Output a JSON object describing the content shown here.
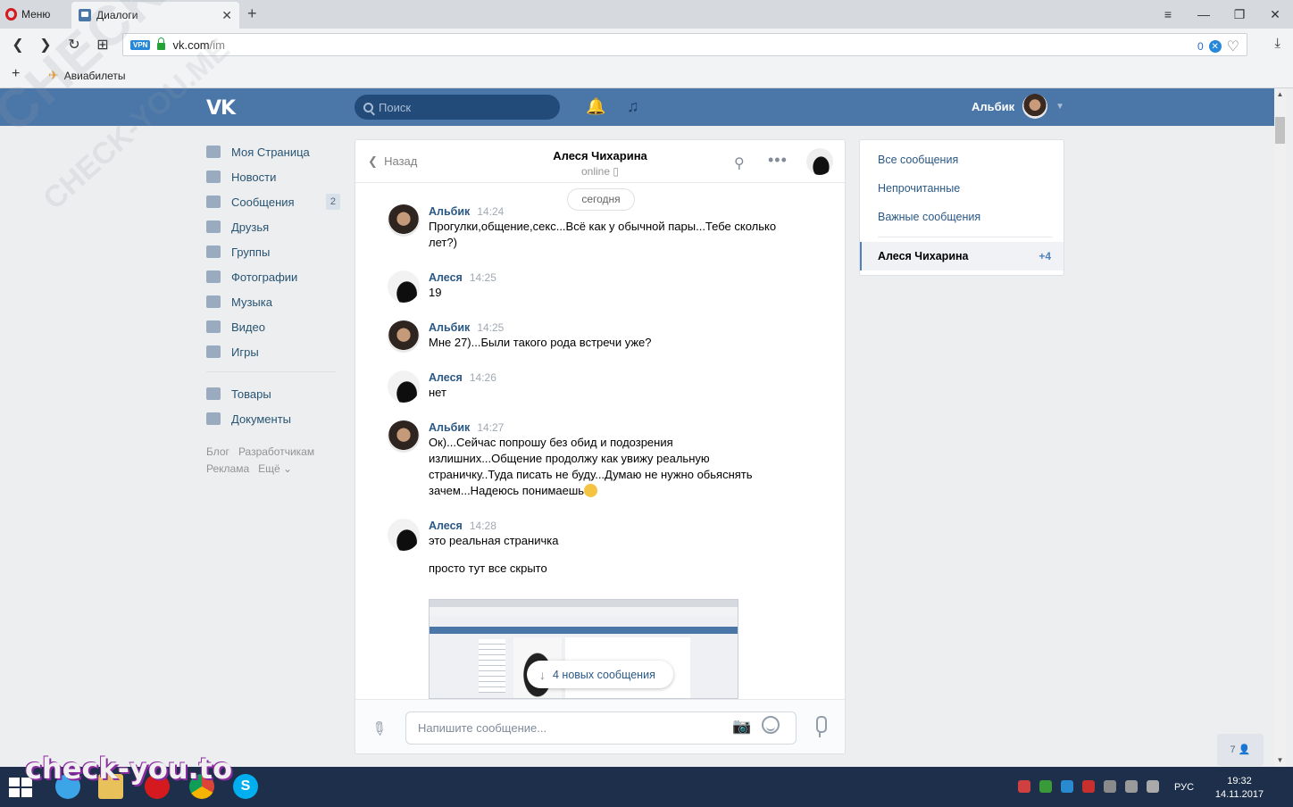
{
  "browser": {
    "menu_label": "Меню",
    "tab_title": "Диалоги",
    "url_host": "vk.com",
    "url_path": "/im",
    "vpn_label": "VPN",
    "adblock_count": "0",
    "bookmark_label": "Авиабилеты"
  },
  "header": {
    "logo": "VK",
    "search_placeholder": "Поиск",
    "user_name": "Альбик"
  },
  "sidebar": {
    "items": [
      {
        "label": "Моя Страница"
      },
      {
        "label": "Новости"
      },
      {
        "label": "Сообщения",
        "badge": "2"
      },
      {
        "label": "Друзья"
      },
      {
        "label": "Группы"
      },
      {
        "label": "Фотографии"
      },
      {
        "label": "Музыка"
      },
      {
        "label": "Видео"
      },
      {
        "label": "Игры"
      }
    ],
    "items2": [
      {
        "label": "Товары"
      },
      {
        "label": "Документы"
      }
    ],
    "footer": {
      "blog": "Блог",
      "developers": "Разработчикам",
      "ads": "Реклама",
      "more": "Ещё ⌄"
    }
  },
  "chat": {
    "back_label": "Назад",
    "peer_name": "Алеся Чихарина",
    "peer_status": "online",
    "date_label": "сегодня",
    "messages": [
      {
        "author": "Альбик",
        "time": "14:24",
        "text": "Прогулки,общение,секс...Всё как у обычной пары...Тебе сколько лет?)"
      },
      {
        "author": "Алеся",
        "time": "14:25",
        "text": "19"
      },
      {
        "author": "Альбик",
        "time": "14:25",
        "text": "Мне 27)...Были такого рода встречи уже?"
      },
      {
        "author": "Алеся",
        "time": "14:26",
        "text": "нет"
      },
      {
        "author": "Альбик",
        "time": "14:27",
        "text": "Ок)...Сейчас попрошу без обид и подозрения излишних...Общение продолжу как увижу реальную страничку..Туда писать не буду...Думаю не нужно обьяснять зачем...Надеюсь понимаешь"
      },
      {
        "author": "Алеся",
        "time": "14:28",
        "text": "это реальная страничка",
        "text2": "просто тут все скрыто"
      }
    ],
    "new_messages_label": "4 новых сообщения",
    "input_placeholder": "Напишите сообщение..."
  },
  "right_panel": {
    "all_messages": "Все сообщения",
    "unread": "Непрочитанные",
    "important": "Важные сообщения",
    "active_name": "Алеся Чихарина",
    "active_count": "+4"
  },
  "friends_online": "7",
  "taskbar": {
    "lang": "РУС",
    "time": "19:32",
    "date": "14.11.2017"
  },
  "watermarks": {
    "diagonal": "CHECK-YOU.ME",
    "diagonal2": "CHECK-YOU.ME",
    "bottom": "check-you.to"
  },
  "colors": {
    "vk_blue": "#4a76a8",
    "link": "#2a5885",
    "background": "#edeef0"
  }
}
